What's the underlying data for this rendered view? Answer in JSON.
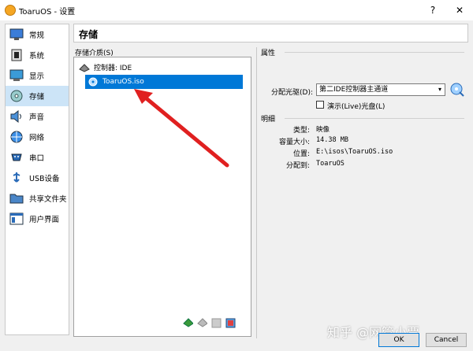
{
  "window": {
    "title": "ToaruOS - 设置",
    "help_glyph": "?",
    "close_glyph": "✕"
  },
  "sidebar": {
    "items": [
      {
        "label": "常规",
        "icon": "monitor-icon"
      },
      {
        "label": "系统",
        "icon": "chip-icon"
      },
      {
        "label": "显示",
        "icon": "display-icon"
      },
      {
        "label": "存储",
        "icon": "storage-icon",
        "active": true
      },
      {
        "label": "声音",
        "icon": "speaker-icon"
      },
      {
        "label": "网络",
        "icon": "network-icon"
      },
      {
        "label": "串口",
        "icon": "serial-port-icon"
      },
      {
        "label": "USB设备",
        "icon": "usb-icon"
      },
      {
        "label": "共享文件夹",
        "icon": "folder-icon"
      },
      {
        "label": "用户界面",
        "icon": "ui-icon"
      }
    ]
  },
  "main": {
    "page_title": "存储",
    "media_label": "存储介质(S)",
    "controller_label": "控制器: IDE",
    "selected_item": "ToaruOS.iso"
  },
  "props": {
    "attributes_head": "属性",
    "drive_label": "分配光驱(D):",
    "drive_value": "第二IDE控制器主通道",
    "live_cd_label": "演示(Live)光盘(L)",
    "details_head": "明细",
    "type_label": "类型:",
    "type_value": "映像",
    "size_label": "容量大小:",
    "size_value": "14.38  MB",
    "location_label": "位置:",
    "location_value": "E:\\isos\\ToaruOS.iso",
    "assigned_label": "分配到:",
    "assigned_value": "ToaruOS"
  },
  "footer": {
    "ok": "OK",
    "cancel": "Cancel"
  },
  "watermark": "知乎 @网管小贾",
  "colors": {
    "selection": "#0078d7",
    "arrow": "#e02020",
    "active_side": "#cce4f7"
  }
}
